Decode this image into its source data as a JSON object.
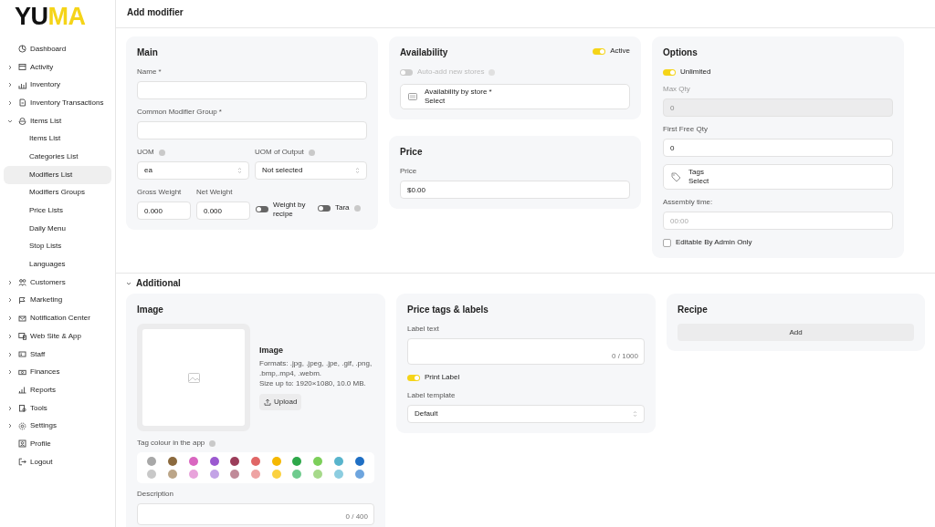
{
  "logo": [
    {
      "text": "YU",
      "color": "#111111"
    },
    {
      "text": "MA",
      "color": "#f5d418"
    }
  ],
  "sidebar": {
    "items": [
      {
        "label": "Dashboard",
        "expandable": false,
        "selected": false
      },
      {
        "label": "Activity",
        "expandable": true,
        "expanded": false,
        "selected": false
      },
      {
        "label": "Inventory",
        "expandable": true,
        "expanded": false,
        "selected": false
      },
      {
        "label": "Inventory Transactions",
        "expandable": true,
        "expanded": false,
        "selected": false
      },
      {
        "label": "Items List",
        "expandable": true,
        "expanded": true,
        "selected": false,
        "children": [
          {
            "label": "Items List",
            "selected": false
          },
          {
            "label": "Categories List",
            "selected": false
          },
          {
            "label": "Modifiers List",
            "selected": true
          },
          {
            "label": "Modifiers Groups",
            "selected": false
          },
          {
            "label": "Price Lists",
            "selected": false
          },
          {
            "label": "Daily Menu",
            "selected": false
          },
          {
            "label": "Stop Lists",
            "selected": false
          },
          {
            "label": "Languages",
            "selected": false
          }
        ]
      },
      {
        "label": "Customers",
        "expandable": true,
        "expanded": false,
        "selected": false
      },
      {
        "label": "Marketing",
        "expandable": true,
        "expanded": false,
        "selected": false
      },
      {
        "label": "Notification Center",
        "expandable": true,
        "expanded": false,
        "selected": false
      },
      {
        "label": "Web Site & App",
        "expandable": true,
        "expanded": false,
        "selected": false
      },
      {
        "label": "Staff",
        "expandable": true,
        "expanded": false,
        "selected": false
      },
      {
        "label": "Finances",
        "expandable": true,
        "expanded": false,
        "selected": false
      },
      {
        "label": "Reports",
        "expandable": false,
        "selected": false
      },
      {
        "label": "Tools",
        "expandable": true,
        "expanded": false,
        "selected": false
      },
      {
        "label": "Settings",
        "expandable": true,
        "expanded": false,
        "selected": false
      },
      {
        "label": "Profile",
        "expandable": false,
        "selected": false
      },
      {
        "label": "Logout",
        "expandable": false,
        "selected": false
      }
    ]
  },
  "page_title": "Add modifier",
  "main": {
    "title": "Main",
    "name": {
      "label": "Name *"
    },
    "group": {
      "label": "Common Modifier Group *"
    },
    "uom": {
      "label": "UOM",
      "value": "ea"
    },
    "uom_output": {
      "label": "UOM of Output",
      "value": "Not selected"
    },
    "gross_weight": {
      "label": "Gross Weight",
      "value": "0.000"
    },
    "net_weight": {
      "label": "Net Weight",
      "value": "0.000"
    },
    "weight_by_recipe": {
      "label": "Weight by recipe",
      "on": false
    },
    "tara": {
      "label": "Tara",
      "on": false
    }
  },
  "availability": {
    "title": "Availability",
    "active": {
      "label": "Active",
      "on": true
    },
    "auto_add": {
      "label": "Auto-add new stores",
      "on": false,
      "disabled": true
    },
    "store_picker": {
      "label": "Availability by store *",
      "value": "Select"
    }
  },
  "price": {
    "title": "Price",
    "field": {
      "label": "Price",
      "value": "$0.00"
    }
  },
  "options": {
    "title": "Options",
    "unlimited": {
      "label": "Unlimited",
      "on": true
    },
    "max_qty": {
      "label": "Max Qty",
      "value": "0",
      "disabled": true
    },
    "first_free_qty": {
      "label": "First Free Qty",
      "value": "0",
      "disabled": false
    },
    "tags": {
      "label": "Tags",
      "value": "Select"
    },
    "assembly_time": {
      "label": "Assembly time:",
      "placeholder": "00:00"
    },
    "admin_only": {
      "label": "Editable By Admin Only",
      "checked": false
    }
  },
  "additional": {
    "title": "Additional",
    "expanded": true
  },
  "image": {
    "title": "Image",
    "heading": "Image",
    "formats": "Formats: .jpg, .jpeg, .jpe, .gif, .png, .bmp,.mp4, .webm.",
    "size": "Size up to: 1920×1080, 10.0 MB.",
    "upload": "Upload",
    "tag_colour_label": "Tag colour in the app",
    "color_rows": [
      [
        {
          "color": "#a8a8a8"
        },
        {
          "color": "#8b6a3e"
        },
        {
          "color": "#d966c0"
        },
        {
          "color": "#9b59d0"
        },
        {
          "color": "#9b3d5a"
        },
        {
          "color": "#e06666"
        },
        {
          "color": "#f5b800"
        },
        {
          "color": "#2ea84a"
        },
        {
          "color": "#7ccf5a"
        },
        {
          "color": "#58b4cc"
        },
        {
          "color": "#1f6fc4"
        }
      ],
      [
        {
          "color": "#c8c8c8"
        },
        {
          "color": "#bba588"
        },
        {
          "color": "#e8a3db"
        },
        {
          "color": "#c3a3e6"
        },
        {
          "color": "#c08a98"
        },
        {
          "color": "#eea3a3"
        },
        {
          "color": "#fbd13f"
        },
        {
          "color": "#6fcb8e"
        },
        {
          "color": "#a6d98a"
        },
        {
          "color": "#8ccde0"
        },
        {
          "color": "#6ea5de"
        }
      ]
    ],
    "description": {
      "label": "Description",
      "counter": "0 / 400"
    }
  },
  "price_tags": {
    "title": "Price tags & labels",
    "label_text": {
      "label": "Label text",
      "counter": "0 / 1000"
    },
    "print_label": {
      "label": "Print Label",
      "on": true
    },
    "template": {
      "label": "Label template",
      "value": "Default"
    }
  },
  "recipe": {
    "title": "Recipe",
    "add": "Add"
  }
}
